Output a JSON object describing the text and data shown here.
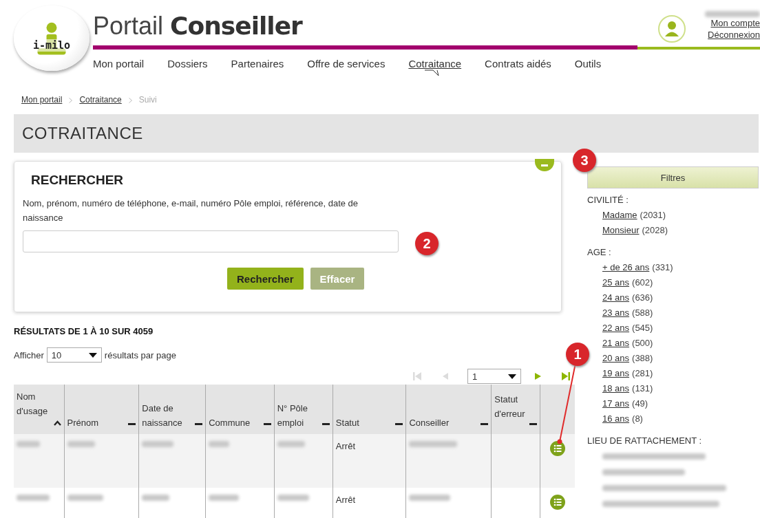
{
  "logo": {
    "text": "i-milo"
  },
  "title": {
    "light": "Portail",
    "bold": "Conseiller"
  },
  "user": {
    "links": [
      "Mon compte",
      "Déconnexion"
    ]
  },
  "nav": [
    {
      "label": "Mon portail",
      "selected": false
    },
    {
      "label": "Dossiers",
      "selected": false
    },
    {
      "label": "Partenaires",
      "selected": false
    },
    {
      "label": "Offre de services",
      "selected": false
    },
    {
      "label": "Cotraitance",
      "selected": true
    },
    {
      "label": "Contrats aidés",
      "selected": false
    },
    {
      "label": "Outils",
      "selected": false
    }
  ],
  "breadcrumb": [
    {
      "label": "Mon portail",
      "link": true
    },
    {
      "label": "Cotraitance",
      "link": true
    },
    {
      "label": "Suivi",
      "link": false
    }
  ],
  "page_title": "COTRAITANCE",
  "search": {
    "expanded": true,
    "title": "RECHERCHER",
    "hint": "Nom, prénom, numéro de téléphone, e-mail, numéro Pôle emploi, référence, date de naissance",
    "buttons": [
      {
        "label": "Rechercher",
        "disabled": false
      },
      {
        "label": "Effacer",
        "disabled": true
      }
    ]
  },
  "results": {
    "title": "RÉSULTATS DE 1 À 10 SUR 4059",
    "show_label": "Afficher",
    "page_size": "10",
    "suffix": "résultats par page",
    "page": "1",
    "pager": [
      {
        "kind": "first",
        "disabled": true
      },
      {
        "kind": "prev",
        "disabled": true
      },
      {
        "kind": "next",
        "disabled": false
      },
      {
        "kind": "last",
        "disabled": false
      }
    ]
  },
  "table": {
    "columns": [
      {
        "label": "Nom d'usage",
        "sorted": true
      },
      {
        "label": "Prénom",
        "sorted": false
      },
      {
        "label": "Date de naissance",
        "sorted": false
      },
      {
        "label": "Commune",
        "sorted": false
      },
      {
        "label": "N° Pôle emploi",
        "sorted": false
      },
      {
        "label": "Statut",
        "sorted": false
      },
      {
        "label": "Conseiller",
        "sorted": false
      },
      {
        "label": "Statut d'erreur",
        "sorted": false
      }
    ],
    "rows": [
      {
        "status": "Arrêt"
      },
      {
        "status": "Arrêt"
      }
    ]
  },
  "filters": {
    "title": "Filtres",
    "groups": [
      {
        "label": "CIVILITÉ :",
        "items": [
          {
            "label": "Madame",
            "count": "(2031)"
          },
          {
            "label": "Monsieur",
            "count": "(2028)"
          }
        ]
      },
      {
        "label": "AGE :",
        "items": [
          {
            "label": "+ de 26 ans",
            "count": "(331)"
          },
          {
            "label": "25 ans",
            "count": "(602)"
          },
          {
            "label": "24 ans",
            "count": "(636)"
          },
          {
            "label": "23 ans",
            "count": "(588)"
          },
          {
            "label": "22 ans",
            "count": "(545)"
          },
          {
            "label": "21 ans",
            "count": "(500)"
          },
          {
            "label": "20 ans",
            "count": "(388)"
          },
          {
            "label": "19 ans",
            "count": "(281)"
          },
          {
            "label": "18 ans",
            "count": "(131)"
          },
          {
            "label": "17 ans",
            "count": "(49)"
          },
          {
            "label": "16 ans",
            "count": "(8)"
          }
        ]
      },
      {
        "label": "LIEU DE RATTACHEMENT :"
      }
    ]
  },
  "annotations": [
    "1",
    "2",
    "3"
  ]
}
